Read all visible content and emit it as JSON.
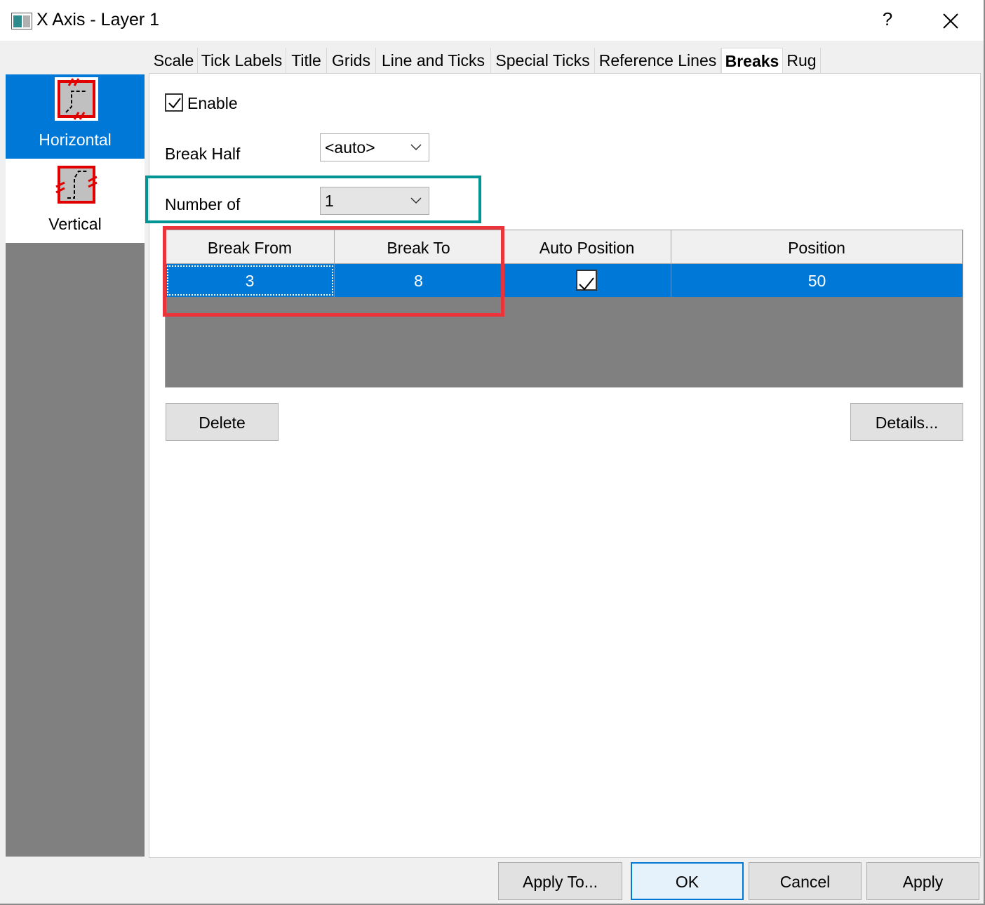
{
  "window": {
    "title": "X Axis - Layer 1",
    "help_label": "?",
    "icons": {
      "app": "worksheet-icon",
      "close": "close-icon"
    }
  },
  "tabs": [
    {
      "label": "Scale",
      "active": false
    },
    {
      "label": "Tick Labels",
      "active": false
    },
    {
      "label": "Title",
      "active": false
    },
    {
      "label": "Grids",
      "active": false
    },
    {
      "label": "Line and Ticks",
      "active": false
    },
    {
      "label": "Special Ticks",
      "active": false
    },
    {
      "label": "Reference Lines",
      "active": false
    },
    {
      "label": "Breaks",
      "active": true
    },
    {
      "label": "Rug",
      "active": false
    }
  ],
  "sidebar": {
    "items": [
      {
        "label": "Horizontal",
        "icon": "horizontal-break-icon",
        "selected": true
      },
      {
        "label": "Vertical",
        "icon": "vertical-break-icon",
        "selected": false
      }
    ]
  },
  "breaks": {
    "enable_label": "Enable",
    "enable_checked": true,
    "break_half_label": "Break Half",
    "break_half_value": "<auto>",
    "number_of_label": "Number of",
    "number_of_value": "1",
    "table": {
      "columns": [
        "Break From",
        "Break To",
        "Auto Position",
        "Position"
      ],
      "rows": [
        {
          "break_from": "3",
          "break_to": "8",
          "auto_position": true,
          "position": "50"
        }
      ]
    },
    "delete_label": "Delete",
    "details_label": "Details..."
  },
  "footer": {
    "apply_to_label": "Apply To...",
    "ok_label": "OK",
    "cancel_label": "Cancel",
    "apply_label": "Apply"
  },
  "colors": {
    "selection": "#0078d7",
    "highlight_teal": "#009494",
    "highlight_red": "#e8343a"
  }
}
